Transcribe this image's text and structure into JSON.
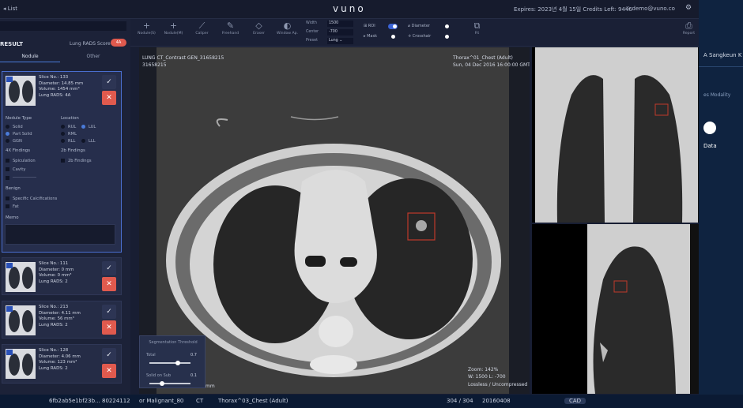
{
  "topbar": {
    "back_label": "◂ List",
    "logo": "vuno",
    "expires": "Expires: 2023년 4월 15일   Credits Left: 9446",
    "user": "demo@vuno.co"
  },
  "result": {
    "title": "RESULT",
    "score_label": "Lung RADS Score",
    "score_value": "4A",
    "tabs": [
      "Nodule",
      "Other"
    ]
  },
  "nodules": [
    {
      "line1": "Slice No.: 133",
      "line2": "Diameter: 14.85 mm",
      "line3": "Volume: 1454 mm³",
      "line4": "Lung RADS: 4A"
    },
    {
      "line1": "Slice No.: 111",
      "line2": "Diameter: 0 mm",
      "line3": "Volume: 0 mm³",
      "line4": "Lung RADS: 2"
    },
    {
      "line1": "Slice No.: 213",
      "line2": "Diameter: 4.11 mm",
      "line3": "Volume: 56 mm³",
      "line4": "Lung RADS: 2"
    },
    {
      "line1": "Slice No.: 128",
      "line2": "Diameter: 4.06 mm",
      "line3": "Volume: 123 mm³",
      "line4": "Lung RADS: 2"
    }
  ],
  "details": {
    "type_title": "Nodule Type",
    "types": [
      "Solid",
      "Part Solid",
      "GGN"
    ],
    "location_title": "Location",
    "locations": [
      "RUL",
      "LUL",
      "RML",
      "RLL",
      "LLL"
    ],
    "findings_4x_title": "4X Findings",
    "findings_4x": [
      "Spiculation",
      "Cavity"
    ],
    "findings_2b_title": "2b Findings",
    "findings_2b": [
      "2b Findings"
    ],
    "benign_title": "Benign",
    "benign": [
      "Specific Calcifications",
      "Fat"
    ],
    "memo_title": "Memo"
  },
  "toolbar": {
    "tools": [
      {
        "label": "Nodule(S)",
        "icon": "plus-icon"
      },
      {
        "label": "Nodule(M)",
        "icon": "plus-icon"
      },
      {
        "label": "Caliper",
        "icon": "ruler-icon"
      },
      {
        "label": "Freehand",
        "icon": "pencil-icon"
      },
      {
        "label": "Eraser",
        "icon": "eraser-icon"
      },
      {
        "label": "Window Ap.",
        "icon": "contrast-icon"
      }
    ],
    "width_label": "Width",
    "width_value": "1500",
    "center_label": "Center",
    "center_value": "-700",
    "preset_label": "Preset",
    "preset_value": "Lung",
    "toggles": [
      {
        "label": "ROI",
        "on": true
      },
      {
        "label": "Mask",
        "on": false
      },
      {
        "label": "Diameter",
        "on": false
      },
      {
        "label": "Crosshair",
        "on": false
      }
    ],
    "fit_label": "Fit",
    "report_label": "Report"
  },
  "axial": {
    "tl1": "LUNG CT_Contrast GEN_31658215",
    "tl2": "31658215",
    "tr1": "Thorax^01_Chest (Adult)",
    "tr2": "Sun, 04 Dec 2016 16:00:00 GMT",
    "br1": "Zoom: 142%",
    "br2": "W: 1500 L: -700",
    "br3": "Lossless / Uncompressed",
    "bl": "mm"
  },
  "segmentation": {
    "title": "Segmentation Threshold",
    "total_label": "Total",
    "total_value": "0.7",
    "total_level": 0.7,
    "solid_label": "Solid on Sub",
    "solid_value": "0.1",
    "solid_level": 0.3
  },
  "bottom": [
    "6fb2ab5e1bf23b...",
    "80224112",
    "or Malignant_80",
    "CT",
    "Thorax^03_Chest (Adult)",
    "304 / 304",
    "20160408",
    "CAD"
  ],
  "bgapp": {
    "user": "A  Sangkeun K",
    "tabs": "es   Modality",
    "data": "Data"
  }
}
